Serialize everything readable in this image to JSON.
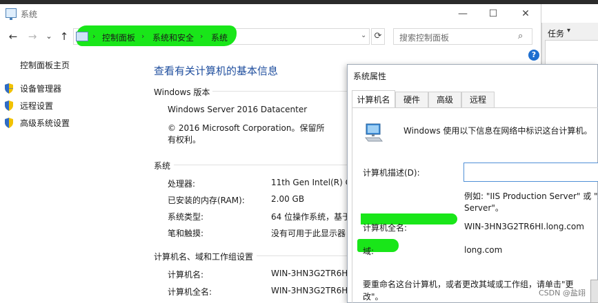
{
  "window": {
    "title": "系统",
    "controls": {
      "minimize": "—",
      "maximize": "☐",
      "close": "✕"
    }
  },
  "nav": {
    "back": "←",
    "forward": "→",
    "recent": "⌄",
    "up": "↑",
    "breadcrumb": [
      "控制面板",
      "系统和安全",
      "系统"
    ],
    "separator": "›",
    "dropdown": "⌄",
    "refresh": "⟳",
    "search_placeholder": "搜索控制面板",
    "search_icon": "⌕"
  },
  "help_icon": "?",
  "sidebar": {
    "home": "控制面板主页",
    "items": [
      {
        "label": "设备管理器",
        "icon": "shield-icon"
      },
      {
        "label": "远程设置",
        "icon": "shield-icon"
      },
      {
        "label": "高级系统设置",
        "icon": "shield-icon"
      }
    ]
  },
  "main": {
    "title": "查看有关计算机的基本信息",
    "edition": {
      "heading": "Windows 版本",
      "name": "Windows Server 2016 Datacenter",
      "copyright_line1": "© 2016 Microsoft Corporation。保留所",
      "copyright_line2": "有权利。"
    },
    "system": {
      "heading": "系统",
      "rows": [
        {
          "label": "处理器:",
          "value": "11th Gen Intel(R) Co"
        },
        {
          "label": "已安装的内存(RAM):",
          "value": "2.00 GB"
        },
        {
          "label": "系统类型:",
          "value": "64 位操作系统，基于"
        },
        {
          "label": "笔和触摸:",
          "value": "没有可用于此显示器"
        }
      ]
    },
    "computer": {
      "heading": "计算机名、域和工作组设置",
      "rows": [
        {
          "label": "计算机名:",
          "value": "WIN-3HN3G2TR6HI"
        },
        {
          "label": "计算机全名:",
          "value": "WIN-3HN3G2TR6HI"
        }
      ]
    }
  },
  "right_panel": {
    "task_label": "任务",
    "arrow": "▾"
  },
  "dialog": {
    "title": "系统属性",
    "tabs": [
      "计算机名",
      "硬件",
      "高级",
      "远程"
    ],
    "intro": "Windows 使用以下信息在网络中标识这台计算机。",
    "description_label": "计算机描述(D):",
    "description_value": "",
    "example_line1": "例如: \"IIS Production Server\" 或 \"A",
    "example_line2": "Server\"。",
    "fullname_label": "计算机全名:",
    "fullname_value": "WIN-3HN3G2TR6HI.long.com",
    "domain_label": "域:",
    "domain_value": "long.com",
    "rename_line1": "要重命名这台计算机，或者更改其域或工作组，请单击\"更",
    "rename_line2": "改\"。"
  },
  "watermark": "CSDN @盐翊",
  "colors": {
    "highlight": "#19e619",
    "title_blue": "#1f4e9e",
    "help_blue": "#1e6fd0"
  }
}
